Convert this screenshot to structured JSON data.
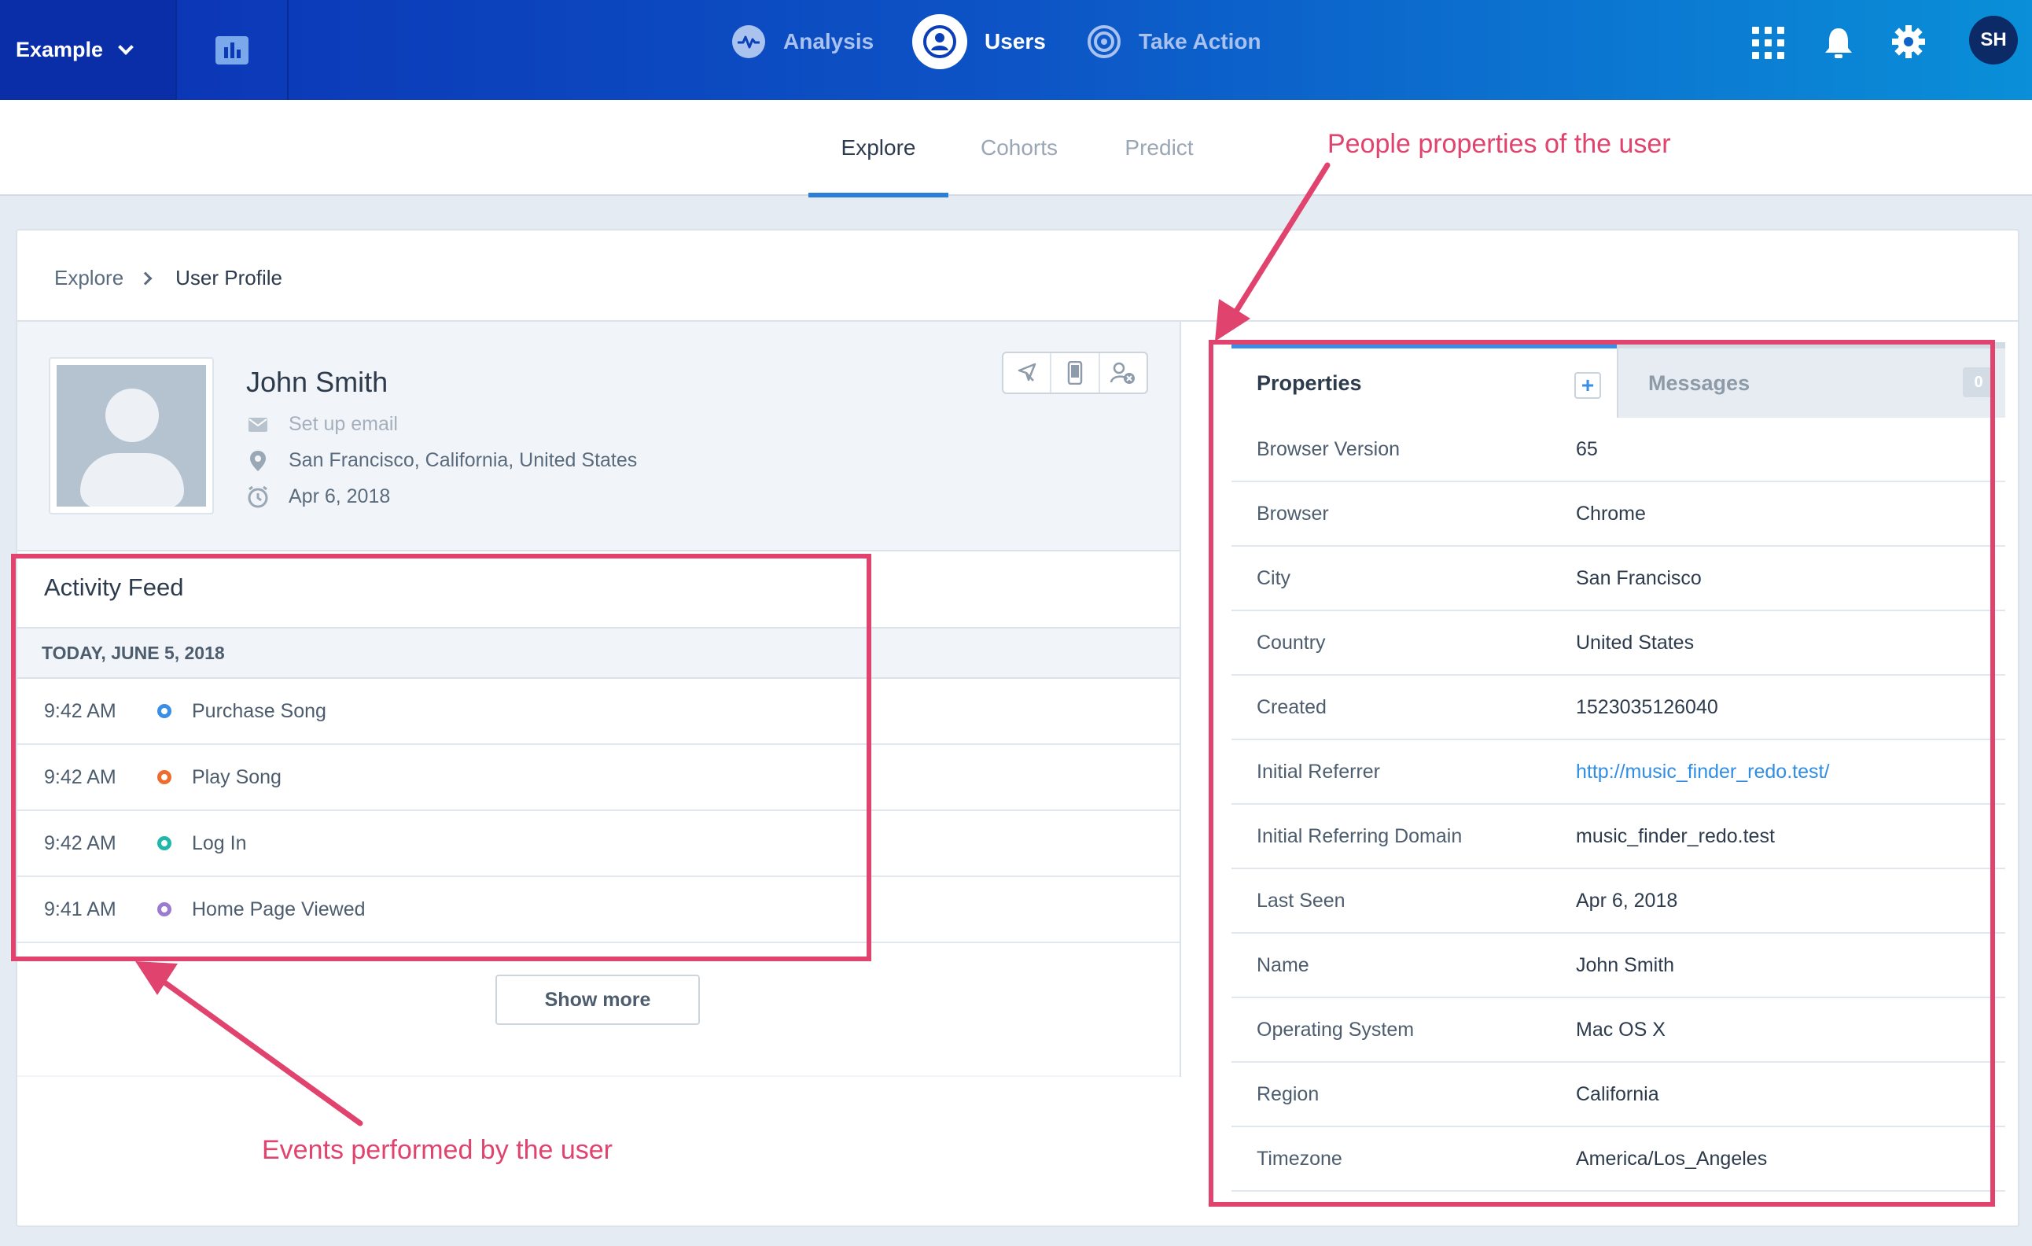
{
  "topbar": {
    "project_label": "Example",
    "nav": [
      {
        "label": "Analysis",
        "icon": "pulse-icon"
      },
      {
        "label": "Users",
        "icon": "user-circle-icon",
        "active": true
      },
      {
        "label": "Take Action",
        "icon": "target-icon"
      }
    ],
    "right_icons": [
      "apps-grid-icon",
      "bell-icon",
      "gear-icon"
    ],
    "user_initials": "SH"
  },
  "subnav": {
    "tabs": [
      {
        "label": "Explore",
        "active": true
      },
      {
        "label": "Cohorts"
      },
      {
        "label": "Predict"
      }
    ]
  },
  "breadcrumb": {
    "parent": "Explore",
    "current": "User Profile"
  },
  "profile": {
    "name": "John Smith",
    "email_placeholder": "Set up email",
    "location": "San Francisco, California, United States",
    "date": "Apr 6, 2018",
    "actions": [
      "cursor-icon",
      "mobile-icon",
      "remove-user-icon"
    ]
  },
  "activity_feed": {
    "title": "Activity Feed",
    "date_header": "TODAY, JUNE 5, 2018",
    "events": [
      {
        "time": "9:42 AM",
        "name": "Purchase Song",
        "color": "#3a8ee6"
      },
      {
        "time": "9:42 AM",
        "name": "Play Song",
        "color": "#ef6c2e"
      },
      {
        "time": "9:42 AM",
        "name": "Log In",
        "color": "#22b8a8"
      },
      {
        "time": "9:41 AM",
        "name": "Home Page Viewed",
        "color": "#9a7bd0"
      }
    ],
    "show_more": "Show more"
  },
  "properties_panel": {
    "tab_properties": "Properties",
    "tab_add": "+",
    "tab_messages": "Messages",
    "messages_count": "0",
    "rows": [
      {
        "key": "Browser Version",
        "value": "65"
      },
      {
        "key": "Browser",
        "value": "Chrome"
      },
      {
        "key": "City",
        "value": "San Francisco"
      },
      {
        "key": "Country",
        "value": "United States"
      },
      {
        "key": "Created",
        "value": "1523035126040"
      },
      {
        "key": "Initial Referrer",
        "value": "http://music_finder_redo.test/",
        "is_link": true
      },
      {
        "key": "Initial Referring Domain",
        "value": "music_finder_redo.test"
      },
      {
        "key": "Last Seen",
        "value": "Apr 6, 2018"
      },
      {
        "key": "Name",
        "value": "John Smith"
      },
      {
        "key": "Operating System",
        "value": "Mac OS X"
      },
      {
        "key": "Region",
        "value": "California"
      },
      {
        "key": "Timezone",
        "value": "America/Los_Angeles"
      }
    ]
  },
  "annotations": {
    "properties_note": "People properties of the user",
    "events_note": "Events performed by the user",
    "color": "#e0436e"
  }
}
